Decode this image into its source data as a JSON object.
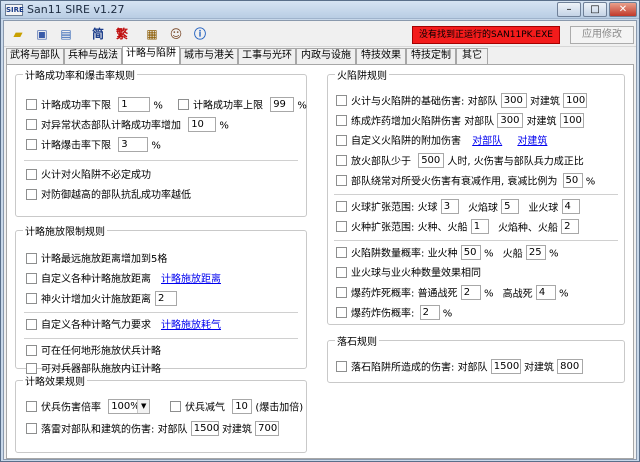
{
  "window": {
    "title": "San11 SIRE v1.27",
    "icon_text": "SIRE"
  },
  "toolbar": {
    "buttons": [
      "folder-open-icon",
      "save-icon",
      "export-icon",
      "simplified-chinese-icon",
      "traditional-chinese-icon",
      "calculator-icon",
      "portrait-icon",
      "info-icon"
    ],
    "simp_label": "简",
    "trad_label": "繁",
    "status_error": "没有找到正运行的SAN11PK.EXE",
    "apply_label": "应用修改"
  },
  "tabs": [
    "武将与部队",
    "兵种与战法",
    "计略与陷阱",
    "城市与港关",
    "工事与光环",
    "内政与设施",
    "特技效果",
    "特技定制",
    "其它"
  ],
  "active_tab": 2,
  "g1": {
    "title": "计略成功率和爆击率规则",
    "min_rate_label": "计略成功率下限",
    "min_rate_val": "1",
    "max_rate_label": "计略成功率上限",
    "max_rate_val": "99",
    "abnormal_label": "对异常状态部队计略成功率增加",
    "abnormal_val": "10",
    "crit_label": "计略爆击率下限",
    "crit_val": "3",
    "fire_note": "火计对火陷阱不必定成功",
    "defense_note": "对防御越高的部队抗乱成功率越低",
    "pct": "%"
  },
  "g2": {
    "title": "计略施放限制规则",
    "r1": "计略最远施放距离增加到5格",
    "r2": "自定义各种计略施放距离",
    "r2_link": "计略施放距离",
    "r3": "神火计增加火计施放距离",
    "r3_val": "2",
    "r4": "自定义各种计略气力要求",
    "r4_link": "计略施放耗气",
    "r5": "可在任何地形施放伏兵计略",
    "r6": "可对兵器部队施放内讧计略"
  },
  "g3": {
    "title": "计略效果规则",
    "ambush_label": "伏兵伤害倍率",
    "ambush_val": "100%",
    "morale_label": "伏兵减气",
    "morale_val": "10",
    "morale_note": "(爆击加倍)",
    "rockfall_label": "落雷对部队和建筑的伤害:",
    "vs_unit": "对部队",
    "vs_unit_val": "1500",
    "vs_bldg": "对建筑",
    "vs_bldg_val": "700"
  },
  "g4": {
    "title": "火陷阱规则",
    "r1": "火计与火陷阱的基础伤害:",
    "r1_unit": "对部队",
    "r1_unit_val": "300",
    "r1_bldg": "对建筑",
    "r1_bldg_val": "100",
    "r2": "练成炸药增加火陷阱伤害",
    "r2_unit": "对部队",
    "r2_unit_val": "300",
    "r2_bldg": "对建筑",
    "r2_bldg_val": "100",
    "r3": "自定义火陷阱的附加伤害",
    "r3_link1": "对部队",
    "r3_link2": "对建筑",
    "r4a": "放火部队少于",
    "r4_val": "500",
    "r4b": "人时, 火伤害与部队兵力成正比",
    "r5": "部队绕常对所受火伤害有衰减作用, 衰减比例为",
    "r5_val": "50",
    "r6": "火球扩张范围:",
    "r6_a": "火球",
    "r6_a_val": "3",
    "r6_b": "火焰球",
    "r6_b_val": "5",
    "r6_c": "业火球",
    "r6_c_val": "4",
    "r7": "火种扩张范围:",
    "r7_a": "火种、火船",
    "r7_a_val": "1",
    "r7_b": "火焰种、火船",
    "r7_b_val": "2",
    "r8": "火陷阱数量概率:",
    "r8_a": "业火种",
    "r8_a_val": "50",
    "r8_b": "火船",
    "r8_b_val": "25",
    "r9": "业火球与业火种数量效果相同",
    "r10": "爆药炸死概率:",
    "r10_a": "普通战死",
    "r10_a_val": "2",
    "r10_b": "高战死",
    "r10_b_val": "4",
    "r11": "爆药炸伤概率:",
    "r11_val": "2",
    "pct": "%"
  },
  "g5": {
    "title": "落石规则",
    "r1": "落石陷阱所造成的伤害:",
    "unit": "对部队",
    "unit_val": "1500",
    "bldg": "对建筑",
    "bldg_val": "800"
  }
}
